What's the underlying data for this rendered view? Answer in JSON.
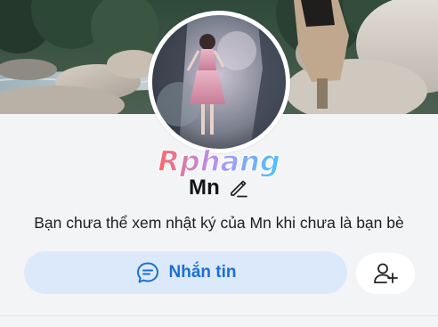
{
  "profile": {
    "name": "Mn",
    "info_message": "Bạn chưa thể xem nhật ký của Mn khi chưa là bạn bè"
  },
  "watermark": {
    "text": "Rphang"
  },
  "actions": {
    "message_label": "Nhắn tin",
    "message_icon": "chat-bubble-icon",
    "add_friend_icon": "add-friend-icon",
    "edit_icon": "pencil-icon"
  },
  "colors": {
    "accent": "#1a6fd8",
    "message_button_bg": "#dce9fb",
    "page_bg": "#f3f4f6"
  }
}
